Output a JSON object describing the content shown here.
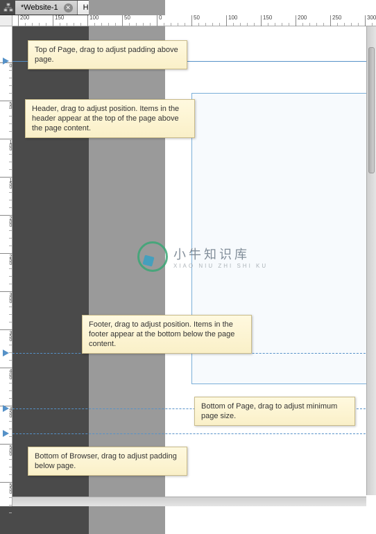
{
  "tabs": [
    {
      "label": "*Website-1",
      "active": false
    },
    {
      "label": "Home",
      "active": true
    }
  ],
  "ruler_h_labels": [
    "200",
    "150",
    "100",
    "50",
    "0",
    "50",
    "100",
    "150",
    "200",
    "250",
    "300"
  ],
  "ruler_v_labels": [
    "0",
    "50",
    "100",
    "150",
    "200",
    "250",
    "300",
    "350",
    "400",
    "450",
    "500",
    "550"
  ],
  "tooltips": {
    "top_of_page": "Top of Page, drag to adjust padding above page.",
    "header": "Header, drag to adjust position. Items in the header appear at the top of the page above the page content.",
    "footer": "Footer, drag to adjust position. Items in the footer appear at the bottom below the page content.",
    "bottom_of_page": "Bottom of Page, drag to adjust minimum page size.",
    "bottom_of_browser": "Bottom of Browser, drag to adjust padding below page."
  },
  "watermark": {
    "main": "小牛知识库",
    "sub": "XIAO NIU ZHI SHI KU"
  }
}
